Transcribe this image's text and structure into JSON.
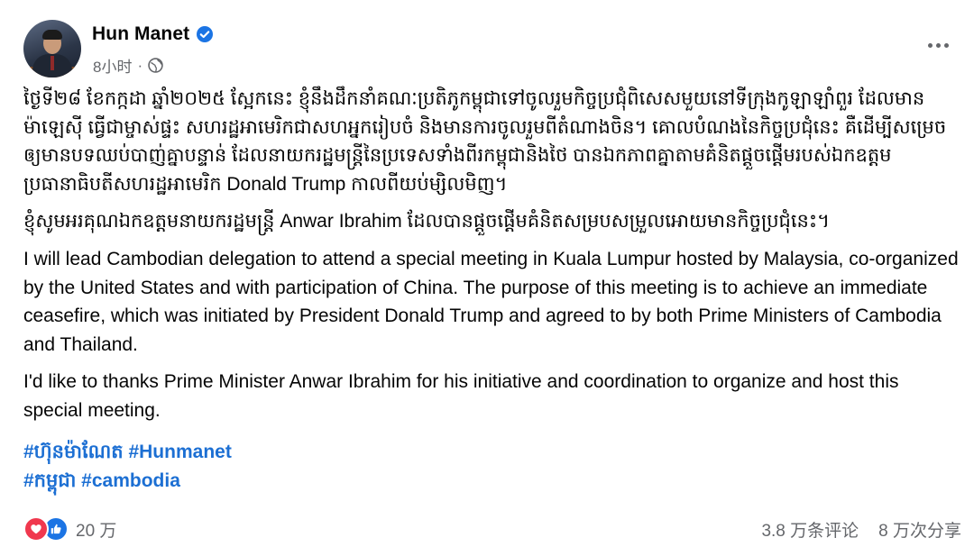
{
  "post": {
    "author": "Hun Manet",
    "timestamp": "8小时",
    "meta_separator": "·",
    "paragraphs_km": [
      "ថ្ងៃទី២៨ ខែកក្កដា ឆ្នាំ២០២៥ ស្អែកនេះ ខ្ញុំនឹងដឹកនាំគណៈប្រតិភូកម្ពុជាទៅចូលរួមកិច្ចប្រជុំពិសេសមួយនៅទីក្រុងកូឡាឡាំពួរ ដែលមានម៉ាឡេស៊ី ធ្វើជាម្ចាស់ផ្ទះ សហរដ្ឋអាមេរិកជាសហអ្នករៀបចំ និងមានការចូលរួមពីតំណាងចិន។ គោលបំណងនៃកិច្ចប្រជុំនេះ គឺដើម្បីសម្រេចឲ្យមានបទឈប់បាញ់គ្នាបន្ទាន់ ដែលនាយករដ្ឋមន្ត្រីនៃប្រទេសទាំងពីរកម្ពុជានិងថៃ បានឯកភាពគ្នាតាមគំនិតផ្តួចផ្តើមរបស់ឯកឧត្តមប្រធានាធិបតីសហរដ្ឋអាមេរិក Donald Trump កាលពីយប់ម្សិលមិញ។",
      "ខ្ញុំសូមអរគុណឯកឧត្តមនាយករដ្ឋមន្ត្រី Anwar Ibrahim ដែលបានផ្តួចផ្តើមគំនិតសម្របសម្រួលអោយមានកិច្ចប្រជុំនេះ។"
    ],
    "paragraphs_en": [
      "I will lead Cambodian delegation to attend a special meeting in Kuala Lumpur hosted by Malaysia, co-organized by the United States and with participation of China. The purpose of this meeting is to achieve an immediate ceasefire, which was initiated by President Donald Trump and agreed to by both Prime Ministers of Cambodia and Thailand.",
      "I'd like to thanks Prime Minister Anwar Ibrahim for his initiative and coordination to organize and host this special meeting."
    ],
    "hashtags": [
      "#ហ៊ុនម៉ាណែត #Hunmanet",
      "#កម្ពុជា #cambodia"
    ]
  },
  "footer": {
    "reaction_count": "20 万",
    "comments": "3.8 万条评论",
    "shares": "8 万次分享"
  },
  "colors": {
    "text": "#050505",
    "secondary": "#65676b",
    "hashtag": "#1c6fd3",
    "verified": "#1b74e4",
    "heart": "#f0384e",
    "like": "#1b74e4"
  }
}
